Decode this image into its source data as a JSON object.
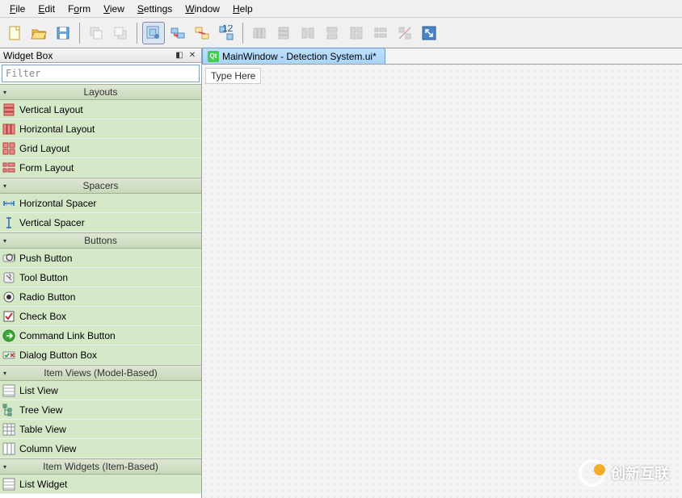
{
  "menu": {
    "file": "File",
    "edit": "Edit",
    "form": "Form",
    "view": "View",
    "settings": "Settings",
    "window": "Window",
    "help": "Help"
  },
  "panel": {
    "title": "Widget Box",
    "filter_placeholder": "Filter"
  },
  "categories": [
    "Layouts",
    "Spacers",
    "Buttons",
    "Item Views (Model-Based)",
    "Item Widgets (Item-Based)"
  ],
  "items": {
    "layouts": [
      "Vertical Layout",
      "Horizontal Layout",
      "Grid Layout",
      "Form Layout"
    ],
    "spacers": [
      "Horizontal Spacer",
      "Vertical Spacer"
    ],
    "buttons": [
      "Push Button",
      "Tool Button",
      "Radio Button",
      "Check Box",
      "Command Link Button",
      "Dialog Button Box"
    ],
    "itemviews": [
      "List View",
      "Tree View",
      "Table View",
      "Column View"
    ],
    "itemwidgets": [
      "List Widget"
    ]
  },
  "tab": {
    "title": "MainWindow - Detection System.ui*",
    "qt": "Qt"
  },
  "canvas": {
    "typehere": "Type Here"
  },
  "watermark": {
    "text": "创新互联",
    "sub": ""
  }
}
